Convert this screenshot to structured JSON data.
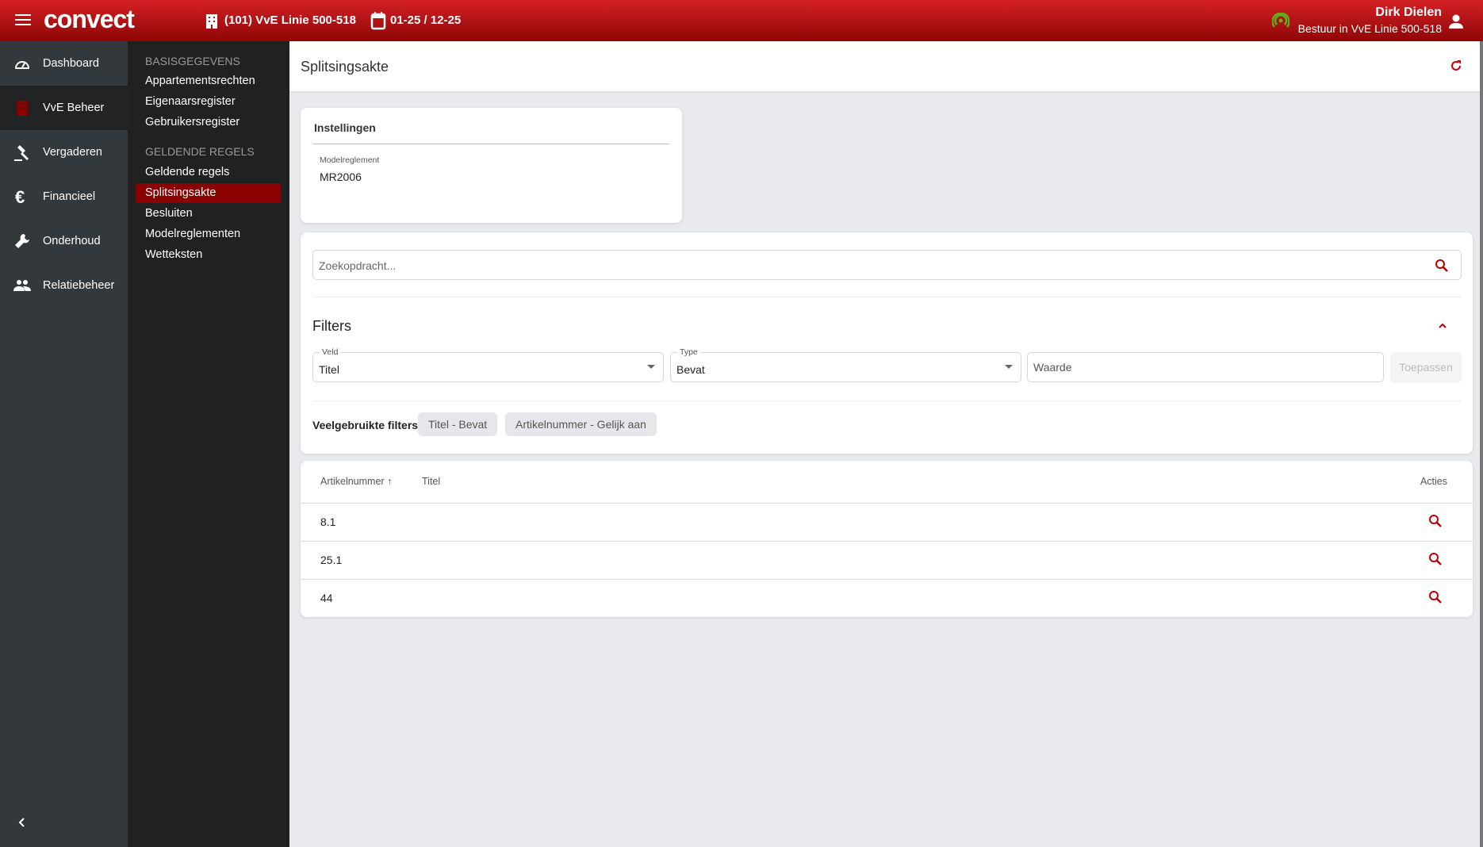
{
  "header": {
    "logo": "convect",
    "vve": "(101) VvE Linie 500-518",
    "period": "01-25 / 12-25",
    "user_name": "Dirk Dielen",
    "user_role": "Bestuur in VvE Linie 500-518"
  },
  "rail": [
    "Dashboard",
    "VvE Beheer",
    "Vergaderen",
    "Financieel",
    "Onderhoud",
    "Relatiebeheer"
  ],
  "sub": {
    "heading1": "BASISGEGEVENS",
    "group1": [
      "Appartementsrechten",
      "Eigenaarsregister",
      "Gebruikersregister"
    ],
    "heading2": "GELDENDE REGELS",
    "group2": [
      "Geldende regels",
      "Splitsingsakte",
      "Besluiten",
      "Modelreglementen",
      "Wetteksten"
    ]
  },
  "page": {
    "title": "Splitsingsakte"
  },
  "settings": {
    "title": "Instellingen",
    "label": "Modelreglement",
    "value": "MR2006"
  },
  "search": {
    "placeholder": "Zoekopdracht..."
  },
  "filters": {
    "title": "Filters",
    "veld_label": "Veld",
    "veld_value": "Titel",
    "type_label": "Type",
    "type_value": "Bevat",
    "waarde_placeholder": "Waarde",
    "apply": "Toepassen",
    "frequent_label": "Veelgebruikte filters",
    "chips": [
      "Titel - Bevat",
      "Artikelnummer - Gelijk aan"
    ]
  },
  "table": {
    "columns": [
      "Artikelnummer",
      "Titel",
      "Acties"
    ],
    "rows": [
      {
        "artikel": "8.1",
        "titel": ""
      },
      {
        "artikel": "25.1",
        "titel": ""
      },
      {
        "artikel": "44",
        "titel": ""
      }
    ]
  },
  "colors": {
    "accent": "#8b0000",
    "status_online": "#5bb318"
  }
}
